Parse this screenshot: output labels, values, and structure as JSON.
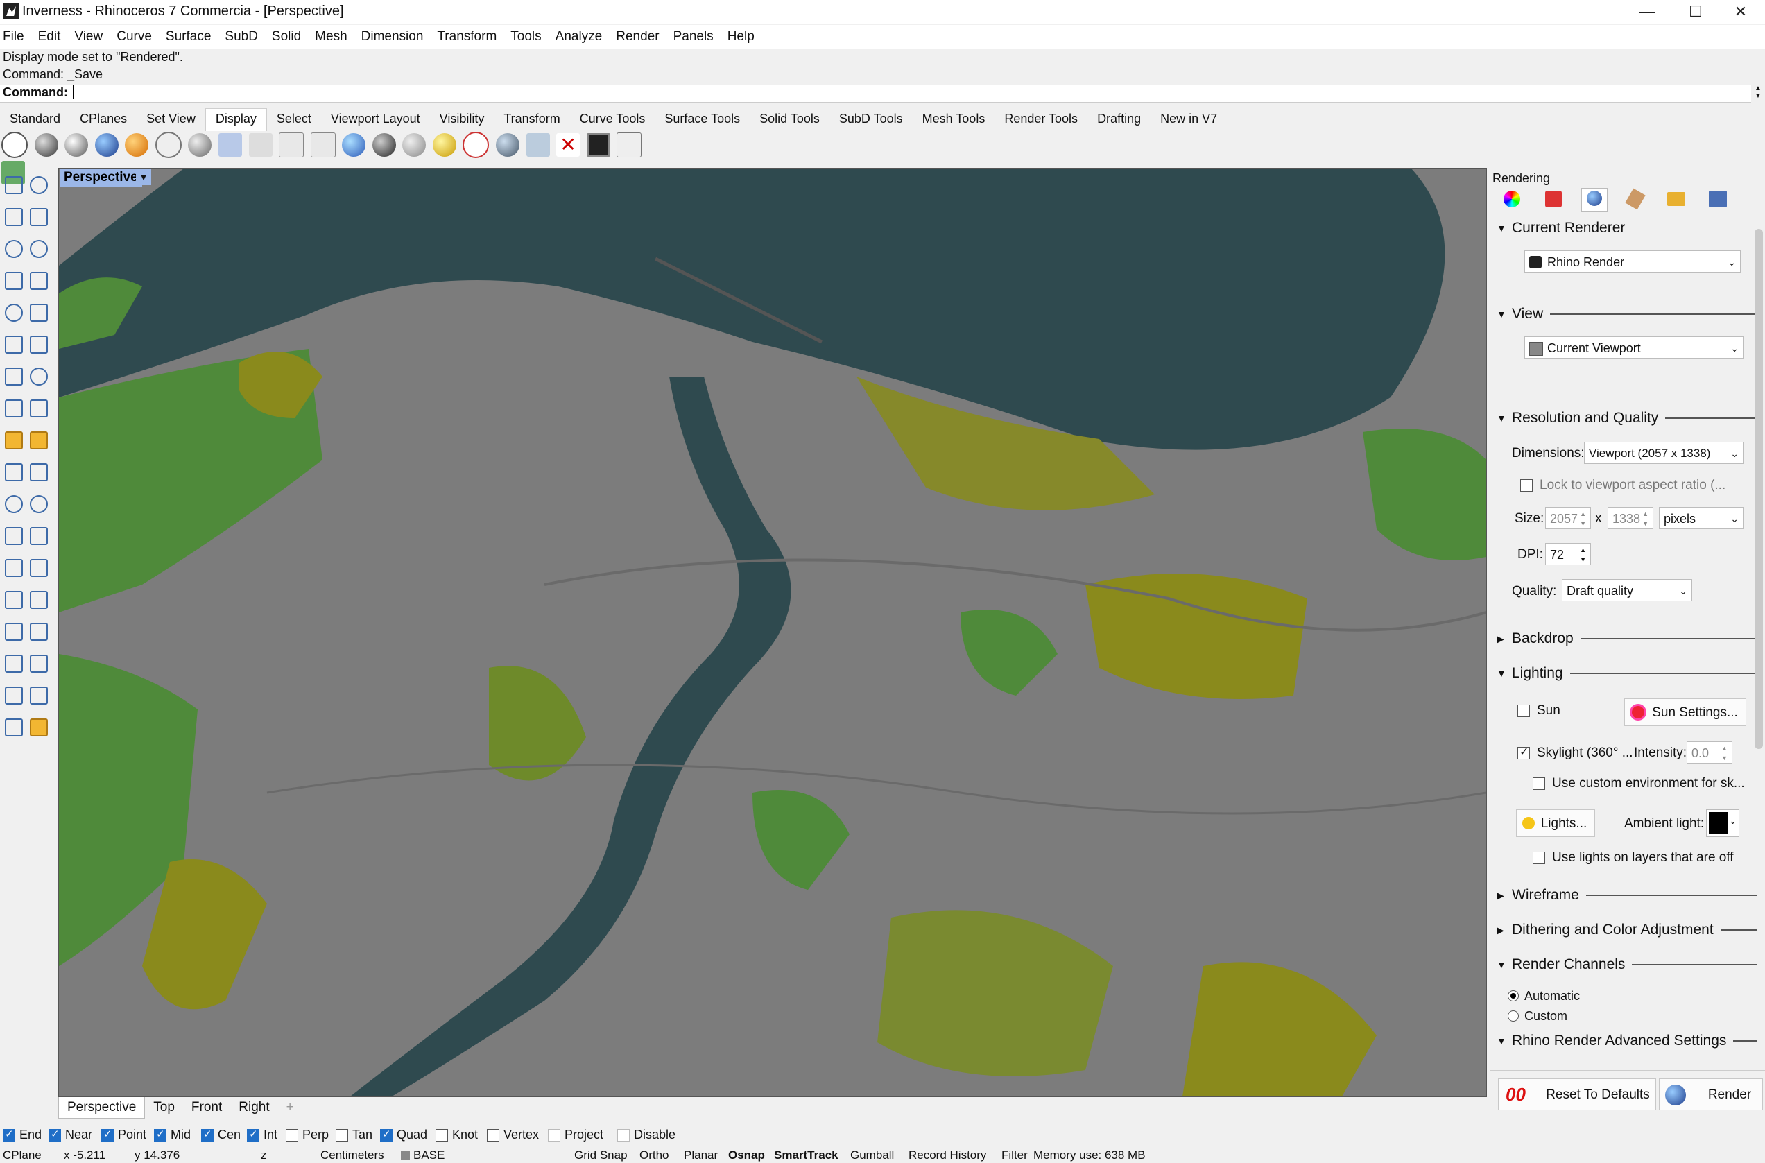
{
  "window": {
    "title": "Inverness - Rhinoceros 7 Commercia - [Perspective]",
    "minimize": "—",
    "maximize": "☐",
    "close": "✕"
  },
  "menu": [
    "File",
    "Edit",
    "View",
    "Curve",
    "Surface",
    "SubD",
    "Solid",
    "Mesh",
    "Dimension",
    "Transform",
    "Tools",
    "Analyze",
    "Render",
    "Panels",
    "Help"
  ],
  "command": {
    "history": [
      "Display mode set to \"Rendered\".",
      "Command: _Save"
    ],
    "prompt": "Command:"
  },
  "toolbar_tabs": [
    "Standard",
    "CPlanes",
    "Set View",
    "Display",
    "Select",
    "Viewport Layout",
    "Visibility",
    "Transform",
    "Curve Tools",
    "Surface Tools",
    "Solid Tools",
    "SubD Tools",
    "Mesh Tools",
    "Render Tools",
    "Drafting",
    "New in V7"
  ],
  "active_tab": "Display",
  "viewport": {
    "label": "Perspective",
    "tabs": [
      "Perspective",
      "Top",
      "Front",
      "Right"
    ],
    "add_tab": "+"
  },
  "panel": {
    "title": "Rendering",
    "current_renderer": {
      "heading": "Current Renderer",
      "value": "Rhino Render"
    },
    "view": {
      "heading": "View",
      "value": "Current Viewport"
    },
    "resolution": {
      "heading": "Resolution and Quality",
      "dimensions_label": "Dimensions:",
      "dimensions_value": "Viewport (2057 x 1338)",
      "lock_label": "Lock to viewport aspect ratio (...",
      "size_label": "Size:",
      "width": "2057",
      "x": "x",
      "height": "1338",
      "unit": "pixels",
      "dpi_label": "DPI:",
      "dpi": "72",
      "quality_label": "Quality:",
      "quality": "Draft quality"
    },
    "backdrop": "Backdrop",
    "lighting": {
      "heading": "Lighting",
      "sun": "Sun",
      "sun_settings": "Sun Settings...",
      "skylight": "Skylight (360° ...",
      "intensity_label": "Intensity:",
      "intensity": "0.0",
      "custom_env": "Use custom environment for sk...",
      "lights": "Lights...",
      "ambient_label": "Ambient light:",
      "use_lights_off": "Use lights on layers that are off"
    },
    "wireframe": "Wireframe",
    "dithering": "Dithering and Color Adjustment",
    "channels": {
      "heading": "Render Channels",
      "automatic": "Automatic",
      "custom": "Custom"
    },
    "advanced": "Rhino Render Advanced Settings",
    "reset": "Reset To Defaults",
    "render": "Render"
  },
  "osnap": [
    {
      "label": "End",
      "on": true
    },
    {
      "label": "Near",
      "on": true
    },
    {
      "label": "Point",
      "on": true
    },
    {
      "label": "Mid",
      "on": true
    },
    {
      "label": "Cen",
      "on": true
    },
    {
      "label": "Int",
      "on": true
    },
    {
      "label": "Perp",
      "on": false
    },
    {
      "label": "Tan",
      "on": false
    },
    {
      "label": "Quad",
      "on": true
    },
    {
      "label": "Knot",
      "on": false
    },
    {
      "label": "Vertex",
      "on": false
    },
    {
      "label": "Project",
      "on": false
    },
    {
      "label": "Disable",
      "on": false
    }
  ],
  "status": {
    "cplane": "CPlane",
    "x": "x -5.211",
    "y": "y 14.376",
    "z": "z",
    "units": "Centimeters",
    "layer": "BASE",
    "grid_snap": "Grid Snap",
    "ortho": "Ortho",
    "planar": "Planar",
    "osnap": "Osnap",
    "smarttrack": "SmartTrack",
    "gumball": "Gumball",
    "record_history": "Record History",
    "filter": "Filter",
    "memory": "Memory use: 638 MB"
  },
  "colors": {
    "water": "#2e4a4e",
    "urban": "#808080",
    "green": "#4f8a3a",
    "olive": "#8a8a1c",
    "viewport_label": "#9bb7e8"
  }
}
